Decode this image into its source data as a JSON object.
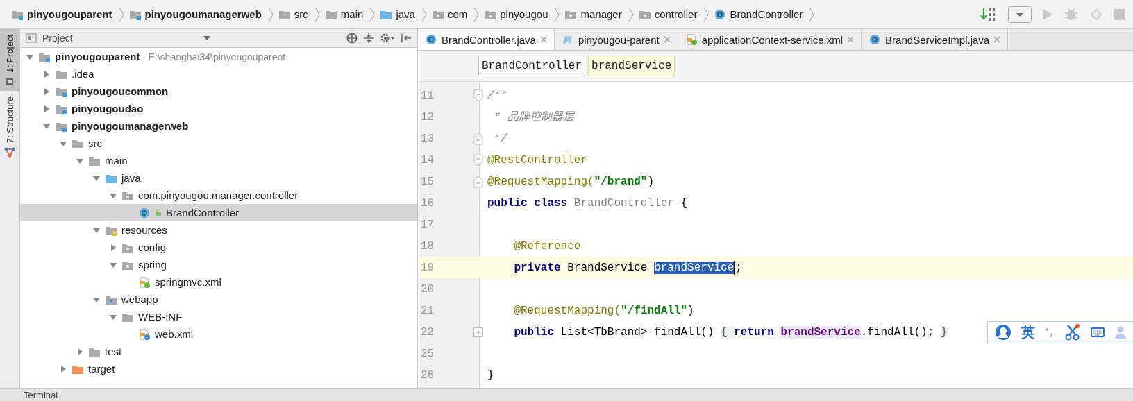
{
  "breadcrumbs": [
    {
      "label": "pinyougouparent",
      "kind": "module"
    },
    {
      "label": "pinyougoumanagerweb",
      "kind": "module"
    },
    {
      "label": "src",
      "kind": "folder"
    },
    {
      "label": "main",
      "kind": "folder"
    },
    {
      "label": "java",
      "kind": "source-folder"
    },
    {
      "label": "com",
      "kind": "package"
    },
    {
      "label": "pinyougou",
      "kind": "package"
    },
    {
      "label": "manager",
      "kind": "package"
    },
    {
      "label": "controller",
      "kind": "package"
    },
    {
      "label": "BrandController",
      "kind": "class"
    }
  ],
  "side_tabs": [
    {
      "label": "1: Project",
      "selected": true,
      "kind": "project"
    },
    {
      "label": "7: Structure",
      "selected": false,
      "kind": "structure"
    }
  ],
  "project_panel": {
    "title": "Project",
    "tree": [
      {
        "label": "pinyougouparent",
        "detail": "E:\\shanghai34\\pinyougouparent",
        "kind": "module",
        "expanded": true,
        "selected": false,
        "children": [
          {
            "label": ".idea",
            "kind": "folder",
            "expanded": false,
            "selected": false
          },
          {
            "label": "pinyougoucommon",
            "kind": "module",
            "expanded": false,
            "selected": false
          },
          {
            "label": "pinyougoudao",
            "kind": "module",
            "expanded": false,
            "selected": false
          },
          {
            "label": "pinyougoumanagerweb",
            "kind": "module",
            "expanded": true,
            "selected": false,
            "children": [
              {
                "label": "src",
                "kind": "folder",
                "expanded": true,
                "selected": false,
                "children": [
                  {
                    "label": "main",
                    "kind": "folder",
                    "expanded": true,
                    "selected": false,
                    "children": [
                      {
                        "label": "java",
                        "kind": "source-folder",
                        "expanded": true,
                        "selected": false,
                        "children": [
                          {
                            "label": "com.pinyougou.manager.controller",
                            "kind": "package",
                            "expanded": true,
                            "selected": false,
                            "children": [
                              {
                                "label": "BrandController",
                                "kind": "class",
                                "selected": true
                              }
                            ]
                          }
                        ]
                      },
                      {
                        "label": "resources",
                        "kind": "resources-folder",
                        "expanded": true,
                        "selected": false,
                        "children": [
                          {
                            "label": "config",
                            "kind": "package",
                            "expanded": false,
                            "selected": false
                          },
                          {
                            "label": "spring",
                            "kind": "package",
                            "expanded": true,
                            "selected": false,
                            "children": [
                              {
                                "label": "springmvc.xml",
                                "kind": "spring-xml",
                                "selected": false
                              }
                            ]
                          }
                        ]
                      },
                      {
                        "label": "webapp",
                        "kind": "web-folder",
                        "expanded": true,
                        "selected": false,
                        "children": [
                          {
                            "label": "WEB-INF",
                            "kind": "folder",
                            "expanded": true,
                            "selected": false,
                            "children": [
                              {
                                "label": "web.xml",
                                "kind": "web-xml",
                                "selected": false
                              }
                            ]
                          }
                        ]
                      }
                    ]
                  },
                  {
                    "label": "test",
                    "kind": "folder",
                    "expanded": false,
                    "selected": false
                  }
                ]
              },
              {
                "label": "target",
                "kind": "excluded-folder",
                "expanded": false,
                "selected": false
              }
            ]
          }
        ]
      }
    ]
  },
  "editor_tabs": [
    {
      "label": "BrandController.java",
      "kind": "class",
      "selected": true
    },
    {
      "label": "pinyougou-parent",
      "kind": "maven",
      "selected": false
    },
    {
      "label": "applicationContext-service.xml",
      "kind": "spring-xml",
      "selected": false
    },
    {
      "label": "BrandServiceImpl.java",
      "kind": "class",
      "selected": false
    }
  ],
  "editor_breadcrumbs": [
    {
      "label": "BrandController",
      "selected": false
    },
    {
      "label": "brandService",
      "selected": true
    }
  ],
  "code_lines": [
    {
      "number": "11",
      "current": false,
      "kind": "fold-start",
      "tokens": [
        {
          "text": "/**",
          "kind": "comment"
        }
      ]
    },
    {
      "number": "12",
      "current": false,
      "kind": "plain",
      "tokens": [
        {
          "text": " * 品牌控制器层",
          "kind": "comment"
        }
      ]
    },
    {
      "number": "13",
      "current": false,
      "kind": "fold-end",
      "tokens": [
        {
          "text": " */",
          "kind": "comment"
        }
      ]
    },
    {
      "number": "14",
      "current": false,
      "kind": "fold-start",
      "tokens": [
        {
          "text": "@RestController",
          "kind": "annotation"
        }
      ]
    },
    {
      "number": "15",
      "current": false,
      "kind": "fold-end",
      "tokens": [
        {
          "text": "@RequestMapping(",
          "kind": "annotation"
        },
        {
          "text": "\"/brand\"",
          "kind": "string"
        },
        {
          "text": ")",
          "kind": "plain"
        }
      ]
    },
    {
      "number": "16",
      "current": false,
      "kind": "plain",
      "tokens": [
        {
          "text": "public class ",
          "kind": "keyword"
        },
        {
          "text": "BrandController",
          "kind": "unused"
        },
        {
          "text": " {",
          "kind": "plain"
        }
      ]
    },
    {
      "number": "17",
      "current": false,
      "kind": "plain"
    },
    {
      "number": "18",
      "current": false,
      "kind": "plain",
      "tokens": [
        {
          "text": "    @Reference",
          "kind": "annotation"
        }
      ]
    },
    {
      "number": "19",
      "current": true,
      "kind": "plain",
      "tokens": [
        {
          "text": "    private ",
          "kind": "keyword"
        },
        {
          "text": "BrandService ",
          "kind": "plain"
        },
        {
          "text": "brandService",
          "kind": "selection"
        },
        {
          "text": ";",
          "kind": "plain"
        }
      ]
    },
    {
      "number": "20",
      "current": false,
      "kind": "plain"
    },
    {
      "number": "21",
      "current": false,
      "kind": "plain",
      "tokens": [
        {
          "text": "    @RequestMapping(",
          "kind": "annotation"
        },
        {
          "text": "\"/findAll\"",
          "kind": "string"
        },
        {
          "text": ")",
          "kind": "plain"
        }
      ]
    },
    {
      "number": "22",
      "current": false,
      "kind": "folded",
      "tokens": [
        {
          "text": "    public ",
          "kind": "keyword"
        },
        {
          "text": "List<TbBrand> findAll() ",
          "kind": "plain"
        },
        {
          "text": "{ ",
          "kind": "folded"
        },
        {
          "text": "return ",
          "kind": "keyword"
        },
        {
          "text": "brandService",
          "kind": "field"
        },
        {
          "text": ".findAll(); ",
          "kind": "plain"
        },
        {
          "text": "}",
          "kind": "folded"
        }
      ]
    },
    {
      "number": "25",
      "current": false,
      "kind": "plain"
    },
    {
      "number": "26",
      "current": false,
      "kind": "plain",
      "tokens": [
        {
          "text": "}",
          "kind": "plain"
        }
      ]
    }
  ],
  "ime_bar": {
    "mode": "英"
  },
  "bottom_bar": {
    "tool_window": "Terminal"
  }
}
